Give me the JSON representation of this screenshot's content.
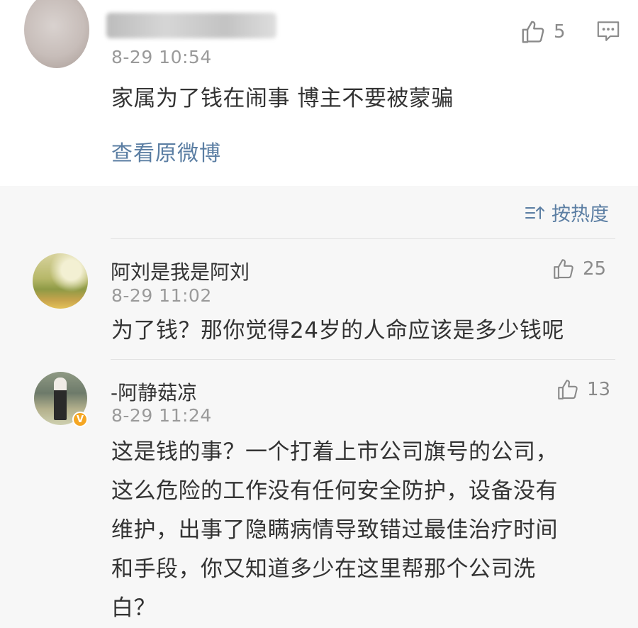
{
  "top_comment": {
    "timestamp": "8-29 10:54",
    "likes": "5",
    "text": "家属为了钱在闹事 博主不要被蒙骗",
    "view_original": "查看原微博"
  },
  "sort": {
    "label": "按热度",
    "icon": "sort-icon"
  },
  "replies": [
    {
      "username": "阿刘是我是阿刘",
      "timestamp": "8-29 11:02",
      "likes": "25",
      "text": "为了钱？那你觉得24岁的人命应该是多少钱呢"
    },
    {
      "username": "-阿静菇凉",
      "timestamp": "8-29 11:24",
      "likes": "13",
      "verified": "V",
      "text_lines": [
        "这是钱的事？一个打着上市公司旗号的公司，",
        "这么危险的工作没有任何安全防护，设备没有",
        "维护，出事了隐瞒病情导致错过最佳治疗时间",
        "和手段，你又知道多少在这里帮那个公司洗",
        "白？"
      ]
    }
  ],
  "colors": {
    "link": "#5b7ea3",
    "muted": "#9a9a9a",
    "text": "#333333",
    "background": "#f7f7f7",
    "card": "#ffffff",
    "verified_badge": "#f5a623"
  }
}
